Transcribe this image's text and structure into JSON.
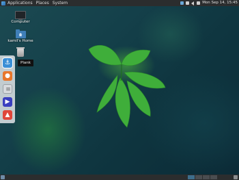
{
  "top_panel": {
    "menus": [
      "Applications",
      "Places",
      "System"
    ],
    "clock": "Mon Sep 14, 15:45"
  },
  "desktop": {
    "icons": [
      {
        "label": "Computer",
        "icon": "computer-icon"
      },
      {
        "label": "kamil's Home",
        "icon": "home-folder-icon"
      },
      {
        "label": "",
        "icon": "trash-icon"
      }
    ]
  },
  "dock": {
    "items": [
      {
        "name": "anchor-app",
        "icon": "anchor-icon"
      },
      {
        "name": "firefox",
        "icon": "firefox-icon"
      },
      {
        "name": "text-editor",
        "icon": "document-icon"
      },
      {
        "name": "media-player",
        "icon": "play-icon"
      },
      {
        "name": "photos",
        "icon": "photo-icon"
      }
    ],
    "tooltip": "Plank"
  },
  "colors": {
    "panel": "#2b2d2e",
    "dock_bg": "#e1e4e8",
    "leaf_green": "#3fae3a"
  }
}
